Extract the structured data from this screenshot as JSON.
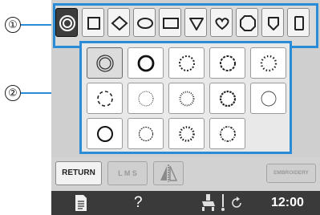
{
  "callouts": [
    "①",
    "②"
  ],
  "shape_tabs": [
    {
      "icon": "double-circle-icon",
      "selected": true
    },
    {
      "icon": "square-icon"
    },
    {
      "icon": "diamond-icon"
    },
    {
      "icon": "oval-icon"
    },
    {
      "icon": "rectangle-icon"
    },
    {
      "icon": "shield-icon"
    },
    {
      "icon": "heart-icon"
    },
    {
      "icon": "octagon-icon"
    },
    {
      "icon": "badge-icon"
    },
    {
      "icon": "tall-rectangle-icon"
    }
  ],
  "frame_styles": [
    "double-line",
    "thick-line",
    "dotted",
    "zigzag",
    "bead",
    "dashed",
    "thin-dots",
    "scalloped",
    "cross-stitch",
    "thin-line",
    "medium-line",
    "star-stitch",
    "decorative",
    "wavy"
  ],
  "selected_frame_index": 0,
  "buttons": {
    "return_label": "RETURN",
    "lms_label": "L M S",
    "embroidery_label": "EMBROIDERY"
  },
  "status": {
    "help_label": "?",
    "clock": "12:00"
  },
  "colors": {
    "accent": "#2a8bd6",
    "panel": "#cfcfcf",
    "status_bar": "#3a3a3a"
  }
}
